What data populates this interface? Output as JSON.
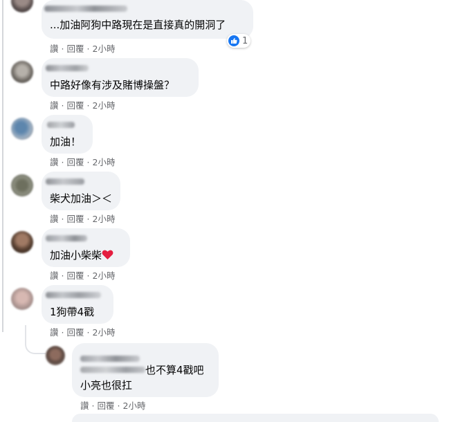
{
  "colors": {
    "bubble": "#f0f2f5",
    "meta_text": "#65676b",
    "like_blue": "#1877f2",
    "heart_red": "#e41e3f"
  },
  "comments": [
    {
      "text": "...加油阿狗中路現在是直接真的開洞了",
      "actions": {
        "like": "讚",
        "reply": "回覆",
        "time": "2小時"
      },
      "reactions": {
        "icon": "like-icon",
        "count": "1"
      }
    },
    {
      "text": "中路好像有涉及賭博操盤？",
      "actions": {
        "like": "讚",
        "reply": "回覆",
        "time": "2小時"
      }
    },
    {
      "text": "加油！",
      "actions": {
        "like": "讚",
        "reply": "回覆",
        "time": "2小時"
      }
    },
    {
      "text": "柴犬加油＞＜",
      "actions": {
        "like": "讚",
        "reply": "回覆",
        "time": "2小時"
      }
    },
    {
      "text": "加油小柴柴",
      "emoji": "heart-icon",
      "actions": {
        "like": "讚",
        "reply": "回覆",
        "time": "2小時"
      }
    },
    {
      "text": "1狗帶4戳",
      "actions": {
        "like": "讚",
        "reply": "回覆",
        "time": "2小時"
      }
    }
  ],
  "reply": {
    "text_line1": "也不算4戳吧",
    "text_line2": "小亮也很扛",
    "actions": {
      "like": "讚",
      "reply": "回覆",
      "time": "2小時"
    }
  },
  "separator": "·"
}
